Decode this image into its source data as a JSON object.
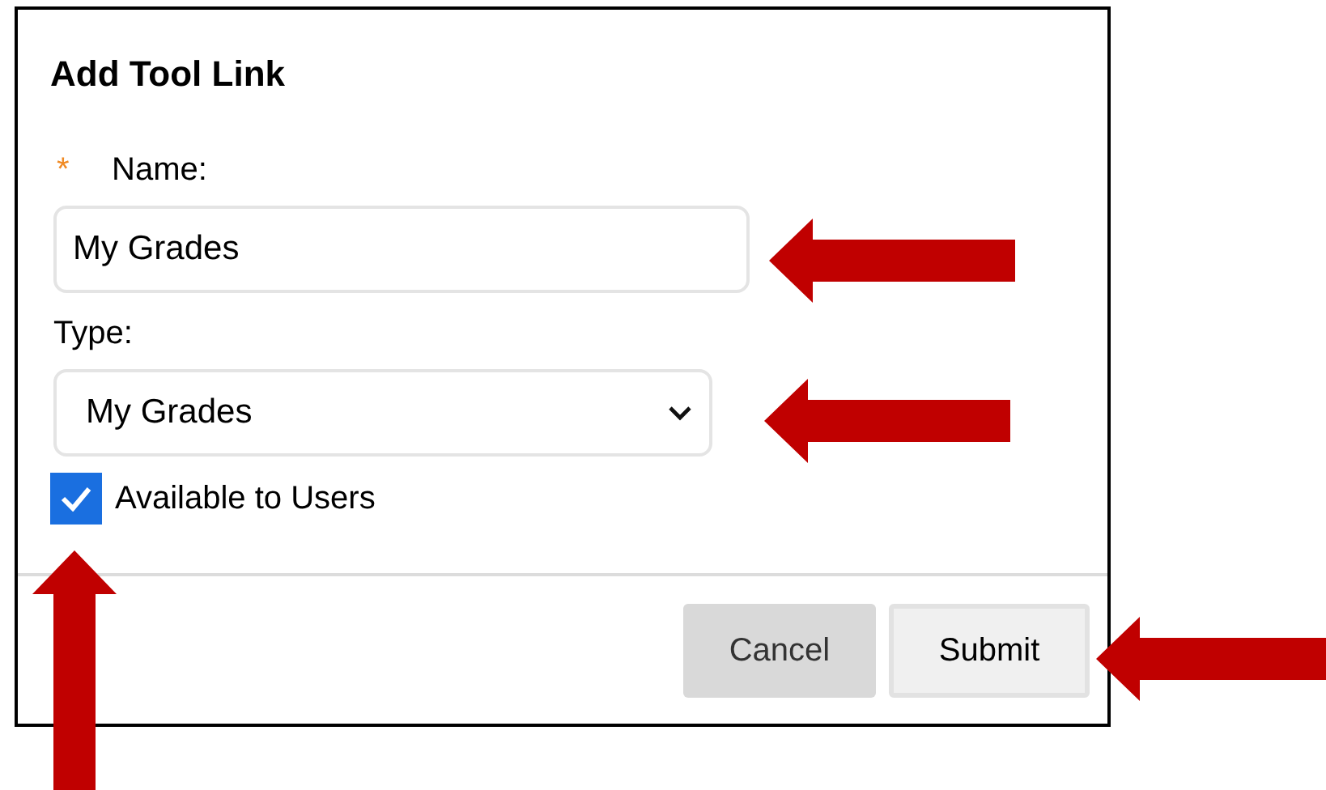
{
  "dialog": {
    "title": "Add Tool Link"
  },
  "name_field": {
    "required_mark": "*",
    "label": "Name:",
    "value": "My Grades"
  },
  "type_field": {
    "label": "Type:",
    "value": "My Grades"
  },
  "available_checkbox": {
    "label": "Available to Users",
    "checked": true
  },
  "buttons": [
    {
      "label": "Cancel",
      "kind": "secondary"
    },
    {
      "label": "Submit",
      "kind": "primary"
    }
  ],
  "annotation_arrows": [
    {
      "kind": "left"
    },
    {
      "kind": "left"
    },
    {
      "kind": "up"
    },
    {
      "kind": "left"
    }
  ]
}
